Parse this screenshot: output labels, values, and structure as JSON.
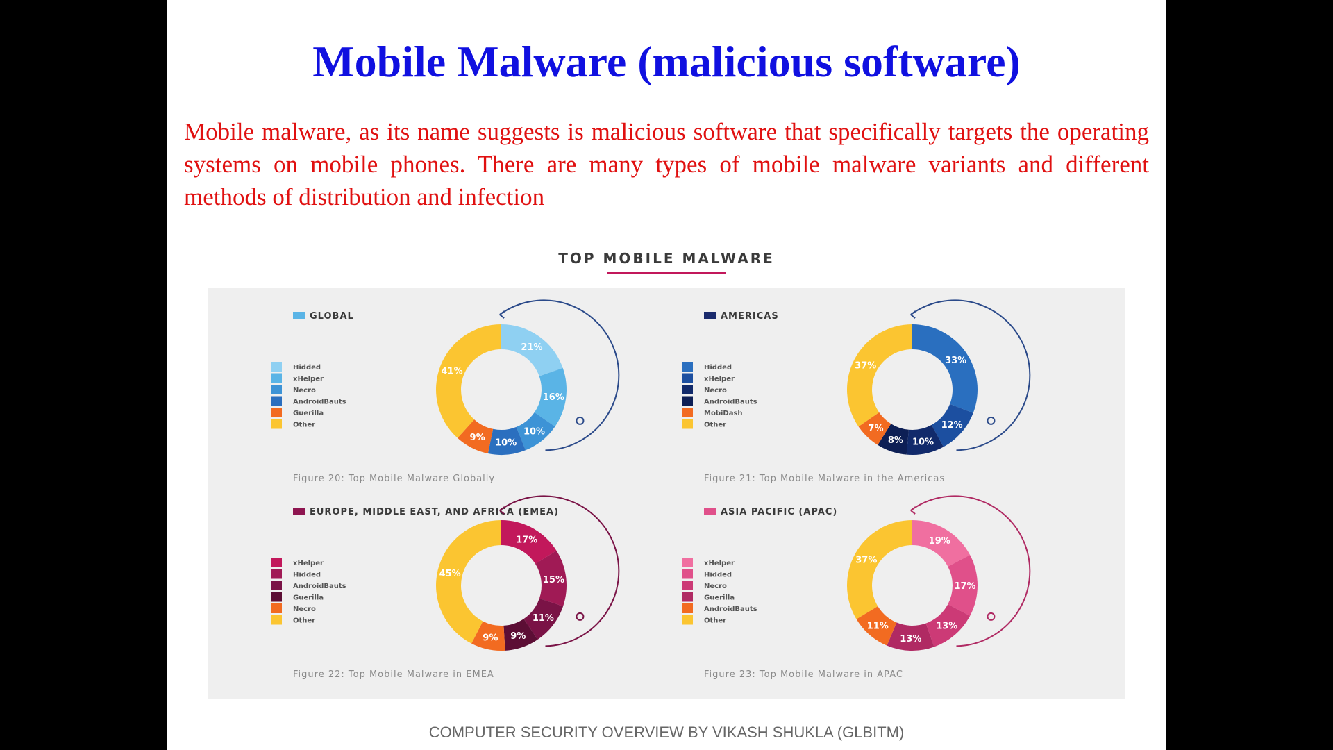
{
  "slide": {
    "title": "Mobile Malware (malicious software)",
    "description": "Mobile malware, as its name suggests is malicious software that specifically targets the operating systems on mobile phones. There are many types of mobile malware variants and different methods of distribution and infection",
    "footer": "COMPUTER SECURITY OVERVIEW BY VIKASH SHUKLA (GLBITM)"
  },
  "infographic": {
    "title": "TOP MOBILE MALWARE"
  },
  "chart_data": [
    {
      "type": "pie",
      "region": "GLOBAL",
      "region_color": "#5ab4e6",
      "caption": "Figure 20: Top Mobile Malware Globally",
      "legend": [
        {
          "label": "Hidded",
          "color": "#8fd0f2"
        },
        {
          "label": "xHelper",
          "color": "#5ab4e6"
        },
        {
          "label": "Necro",
          "color": "#3d93d6"
        },
        {
          "label": "AndroidBauts",
          "color": "#2b6fbf"
        },
        {
          "label": "Guerilla",
          "color": "#f26b21"
        },
        {
          "label": "Other",
          "color": "#fbc531"
        }
      ],
      "slices": [
        {
          "value": 21,
          "label": "21%",
          "color": "#8fd0f2"
        },
        {
          "value": 16,
          "label": "16%",
          "color": "#5ab4e6"
        },
        {
          "value": 10,
          "label": "10%",
          "color": "#3d93d6"
        },
        {
          "value": 10,
          "label": "10%",
          "color": "#2b6fbf"
        },
        {
          "value": 9,
          "label": "9%",
          "color": "#f26b21"
        },
        {
          "value": 41,
          "label": "41%",
          "color": "#fbc531"
        }
      ],
      "arrow_color": "#2b4a8a"
    },
    {
      "type": "pie",
      "region": "AMERICAS",
      "region_color": "#1a2a6c",
      "caption": "Figure 21: Top Mobile Malware in the Americas",
      "legend": [
        {
          "label": "Hidded",
          "color": "#2a6fbf"
        },
        {
          "label": "xHelper",
          "color": "#1c4fa0"
        },
        {
          "label": "Necro",
          "color": "#112a6b"
        },
        {
          "label": "AndroidBauts",
          "color": "#0d1f55"
        },
        {
          "label": "MobiDash",
          "color": "#f26b21"
        },
        {
          "label": "Other",
          "color": "#fbc531"
        }
      ],
      "slices": [
        {
          "value": 33,
          "label": "33%",
          "color": "#2a6fbf"
        },
        {
          "value": 12,
          "label": "12%",
          "color": "#1c4fa0"
        },
        {
          "value": 10,
          "label": "10%",
          "color": "#112a6b"
        },
        {
          "value": 8,
          "label": "8%",
          "color": "#0d1f55"
        },
        {
          "value": 7,
          "label": "7%",
          "color": "#f26b21"
        },
        {
          "value": 37,
          "label": "37%",
          "color": "#fbc531"
        }
      ],
      "arrow_color": "#2b4a8a"
    },
    {
      "type": "pie",
      "region": "EUROPE, MIDDLE EAST, AND AFRICA (EMEA)",
      "region_color": "#8e1550",
      "caption": "Figure 22: Top Mobile Malware in EMEA",
      "legend": [
        {
          "label": "xHelper",
          "color": "#c2185b"
        },
        {
          "label": "Hidded",
          "color": "#a01a55"
        },
        {
          "label": "AndroidBauts",
          "color": "#7a1346"
        },
        {
          "label": "Guerilla",
          "color": "#5c0e35"
        },
        {
          "label": "Necro",
          "color": "#f26b21"
        },
        {
          "label": "Other",
          "color": "#fbc531"
        }
      ],
      "slices": [
        {
          "value": 17,
          "label": "17%",
          "color": "#c2185b"
        },
        {
          "value": 15,
          "label": "15%",
          "color": "#a01a55"
        },
        {
          "value": 11,
          "label": "11%",
          "color": "#7a1346"
        },
        {
          "value": 9,
          "label": "9%",
          "color": "#5c0e35"
        },
        {
          "value": 9,
          "label": "9%",
          "color": "#f26b21"
        },
        {
          "value": 45,
          "label": "45%",
          "color": "#fbc531"
        }
      ],
      "arrow_color": "#7a1346"
    },
    {
      "type": "pie",
      "region": "ASIA PACIFIC (APAC)",
      "region_color": "#e0508a",
      "caption": "Figure 23: Top Mobile Malware in APAC",
      "legend": [
        {
          "label": "xHelper",
          "color": "#f06fa0"
        },
        {
          "label": "Hidded",
          "color": "#e0508a"
        },
        {
          "label": "Necro",
          "color": "#cc3a76"
        },
        {
          "label": "Guerilla",
          "color": "#b02a63"
        },
        {
          "label": "AndroidBauts",
          "color": "#f26b21"
        },
        {
          "label": "Other",
          "color": "#fbc531"
        }
      ],
      "slices": [
        {
          "value": 19,
          "label": "19%",
          "color": "#f06fa0"
        },
        {
          "value": 17,
          "label": "17%",
          "color": "#e0508a"
        },
        {
          "value": 13,
          "label": "13%",
          "color": "#cc3a76"
        },
        {
          "value": 13,
          "label": "13%",
          "color": "#b02a63"
        },
        {
          "value": 11,
          "label": "11%",
          "color": "#f26b21"
        },
        {
          "value": 37,
          "label": "37%",
          "color": "#fbc531"
        }
      ],
      "arrow_color": "#b02a63"
    }
  ]
}
